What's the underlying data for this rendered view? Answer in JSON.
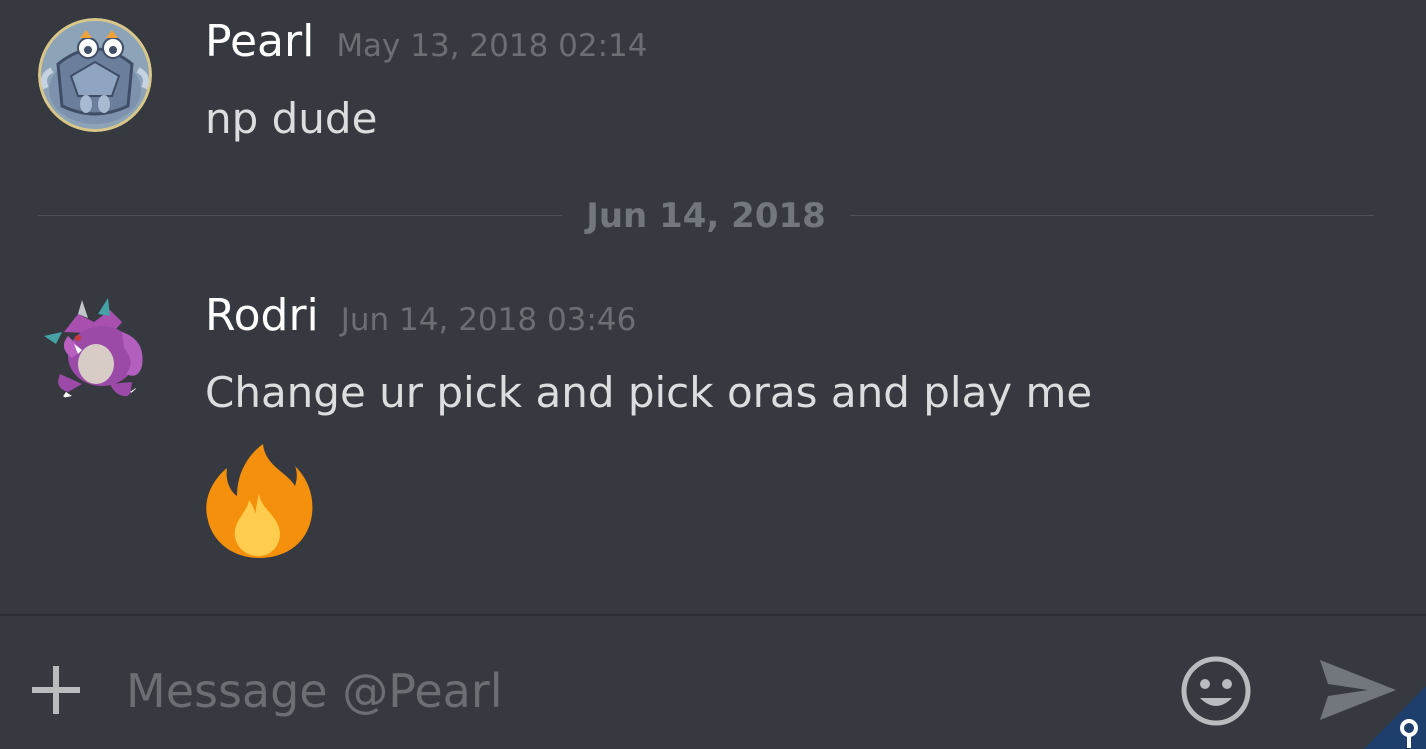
{
  "messages": [
    {
      "author": "Pearl",
      "timestamp": "May 13, 2018 02:14",
      "text": "np dude",
      "avatar_icon": "pokemon-avatar-icon"
    },
    {
      "author": "Rodri",
      "timestamp": "Jun 14, 2018 03:46",
      "text": "Change ur pick and pick oras and play me",
      "avatar_icon": "nidoking-avatar-icon",
      "attachment_emoji": "fire-emoji"
    }
  ],
  "date_divider": "Jun 14, 2018",
  "composer": {
    "placeholder": "Message @Pearl",
    "value": "",
    "icons": [
      "plus-icon",
      "smiley-icon",
      "send-icon"
    ]
  },
  "colors": {
    "background": "#36393f",
    "author": "#ffffff",
    "message_text": "#dcddde",
    "muted": "#6b6e73",
    "accent_badge": "#1e3f6b"
  }
}
